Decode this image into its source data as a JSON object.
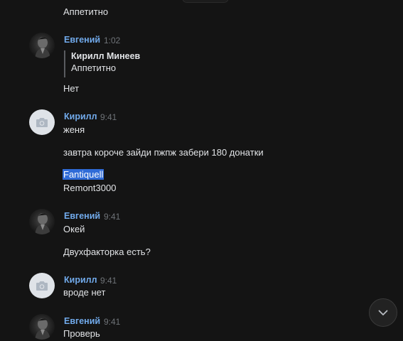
{
  "messages": {
    "m0": {
      "text": "Аппетитно"
    },
    "m1": {
      "author": "Евгений",
      "time": "1:02",
      "quote_author": "Кирилл Минеев",
      "quote_text": "Аппетитно",
      "lines": [
        "Нет"
      ]
    },
    "m2": {
      "author": "Кирилл",
      "time": "9:41",
      "lines": [
        "женя",
        "завтра короче зайди пжпж забери 180 донатки",
        "Fantiquell",
        "Remont3000"
      ]
    },
    "m3": {
      "author": "Евгений",
      "time": "9:41",
      "lines": [
        "Окей",
        "Двухфакторка есть?"
      ]
    },
    "m4": {
      "author": "Кирилл",
      "time": "9:41",
      "lines": [
        "вроде нет"
      ]
    },
    "m5": {
      "author": "Евгений",
      "time": "9:41",
      "lines": [
        "Проверь"
      ]
    }
  },
  "icons": {
    "avatar_evgeny": "user-photo-icon",
    "avatar_kirill": "camera-icon",
    "scroll_down": "chevron-down-icon"
  },
  "colors": {
    "background": "#141414",
    "author_name": "#71aaeb",
    "text": "#e1e3e6",
    "time": "#6f7378",
    "selection": "#2f6bd7"
  }
}
